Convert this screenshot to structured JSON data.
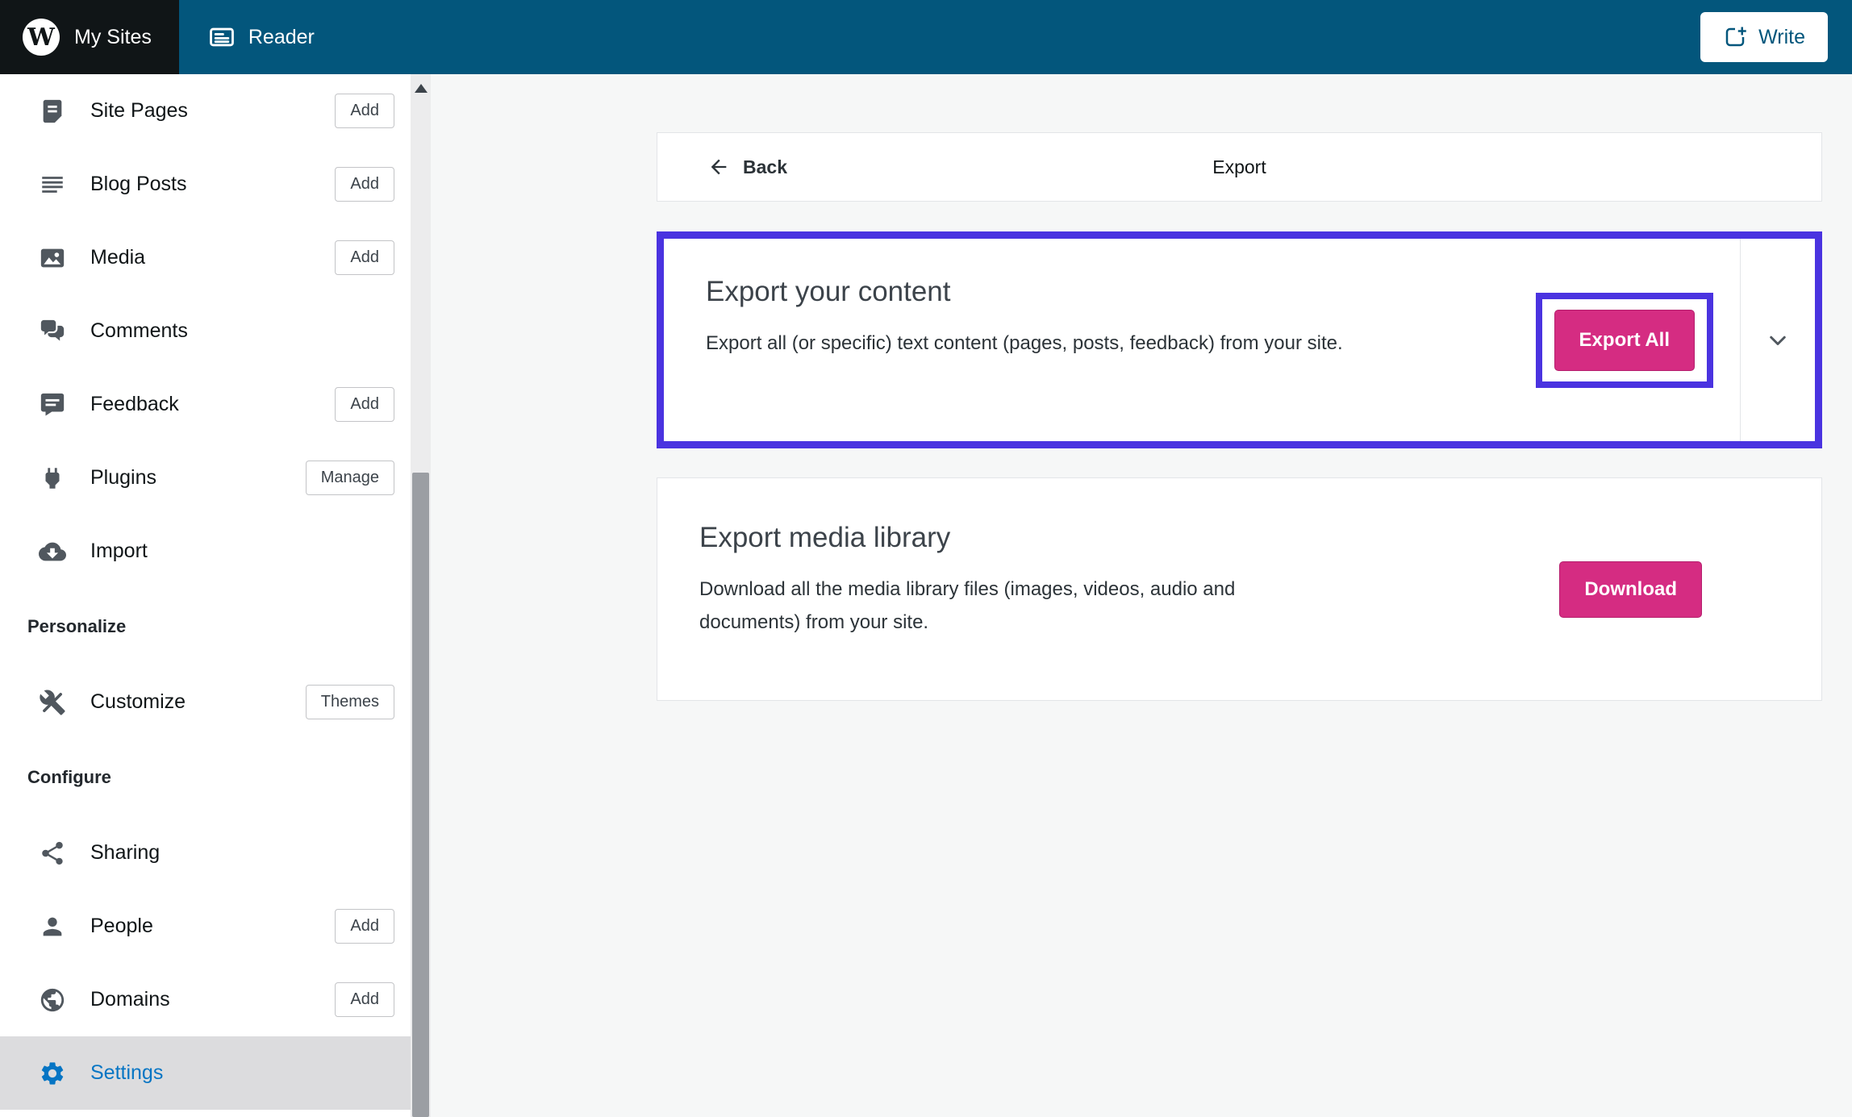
{
  "masthead": {
    "my_sites_label": "My Sites",
    "reader_label": "Reader",
    "write_label": "Write",
    "logo_letter": "W"
  },
  "sidebar": {
    "menu": [
      {
        "label": "Site Pages",
        "badge": "Add",
        "icon": "pages-icon"
      },
      {
        "label": "Blog Posts",
        "badge": "Add",
        "icon": "posts-icon"
      },
      {
        "label": "Media",
        "badge": "Add",
        "icon": "media-icon"
      },
      {
        "label": "Comments",
        "icon": "comments-icon"
      },
      {
        "label": "Feedback",
        "badge": "Add",
        "icon": "feedback-icon"
      },
      {
        "label": "Plugins",
        "badge": "Manage",
        "icon": "plugin-icon"
      },
      {
        "label": "Import",
        "icon": "cloud-import-icon"
      }
    ],
    "personalize": {
      "heading": "Personalize",
      "items": [
        {
          "label": "Customize",
          "badge": "Themes",
          "icon": "customize-tools-icon"
        }
      ]
    },
    "configure": {
      "heading": "Configure",
      "items": [
        {
          "label": "Sharing",
          "icon": "share-icon"
        },
        {
          "label": "People",
          "badge": "Add",
          "icon": "person-icon"
        },
        {
          "label": "Domains",
          "badge": "Add",
          "icon": "globe-icon"
        },
        {
          "label": "Settings",
          "icon": "gear-icon",
          "active": true
        }
      ]
    }
  },
  "main": {
    "header": {
      "back_label": "Back",
      "title": "Export"
    },
    "export_content": {
      "title": "Export your content",
      "description": "Export all (or specific) text content (pages, posts, feedback) from your site.",
      "button_label": "Export All"
    },
    "export_media": {
      "title": "Export media library",
      "description": "Download all the media library files (images, videos, audio and documents) from your site.",
      "button_label": "Download"
    }
  },
  "colors": {
    "masthead_blue": "#03567c",
    "masthead_black": "#101517",
    "accent_pink": "#d52c82",
    "annotation_purple": "#4a33e0",
    "active_blue": "#0675c4",
    "sidebar_active_bg": "#dcdcde",
    "content_bg": "#f6f7f7"
  }
}
